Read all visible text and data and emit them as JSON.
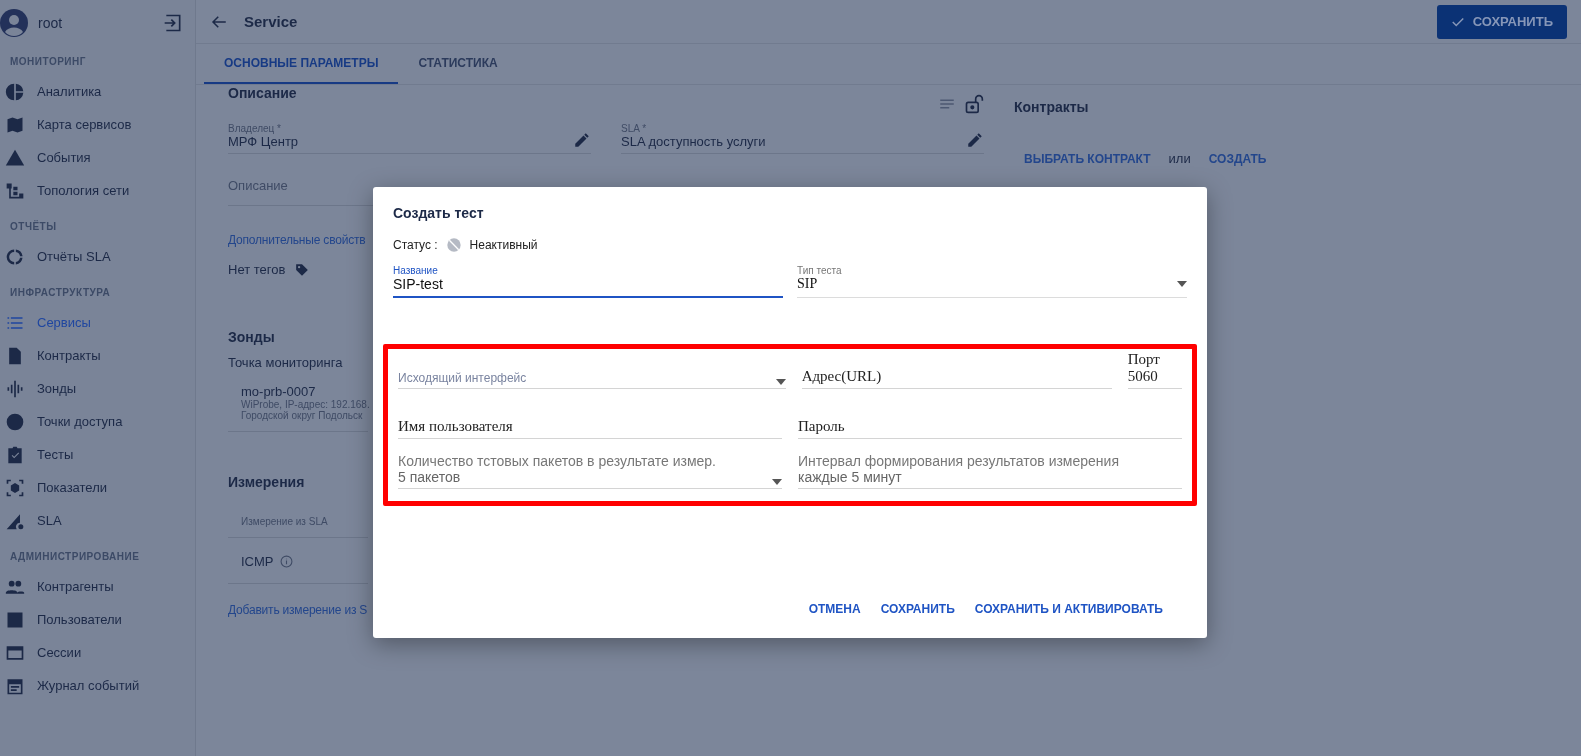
{
  "user": {
    "name": "root"
  },
  "sidebar": [
    {
      "title": "МОНИТОРИНГ",
      "items": [
        {
          "label": "Аналитика",
          "selected": false
        },
        {
          "label": "Карта сервисов",
          "selected": false
        },
        {
          "label": "События",
          "selected": false
        },
        {
          "label": "Топология сети",
          "selected": false
        }
      ]
    },
    {
      "title": "ОТЧЁТЫ",
      "items": [
        {
          "label": "Отчёты SLA",
          "selected": false
        }
      ]
    },
    {
      "title": "ИНФРАСТРУКТУРА",
      "items": [
        {
          "label": "Сервисы",
          "selected": true
        },
        {
          "label": "Контракты",
          "selected": false
        },
        {
          "label": "Зонды",
          "selected": false
        },
        {
          "label": "Точки доступа",
          "selected": false
        },
        {
          "label": "Тесты",
          "selected": false
        },
        {
          "label": "Показатели",
          "selected": false
        },
        {
          "label": "SLA",
          "selected": false
        }
      ]
    },
    {
      "title": "АДМИНИСТРИРОВАНИЕ",
      "items": [
        {
          "label": "Контрагенты",
          "selected": false
        },
        {
          "label": "Пользователи",
          "selected": false
        },
        {
          "label": "Сессии",
          "selected": false
        },
        {
          "label": "Журнал событий",
          "selected": false
        }
      ]
    }
  ],
  "header": {
    "title": "Service",
    "save": "СОХРАНИТЬ"
  },
  "tabs": [
    {
      "label": "ОСНОВНЫЕ ПАРАМЕТРЫ",
      "selected": true
    },
    {
      "label": "СТАТИСТИКА",
      "selected": false
    }
  ],
  "description": {
    "heading": "Описание",
    "owner": {
      "label": "Владелец *",
      "value": "МРФ Центр"
    },
    "sla": {
      "label": "SLA *",
      "value": "SLA доступность услуги"
    },
    "placeholder": "Описание",
    "extra_link": "Дополнительные свойств",
    "tags": "Нет тегов"
  },
  "probes": {
    "heading": "Зонды",
    "label": "Точка мониторинга",
    "name": "mo-prb-0007",
    "line1": "WiProbe, IP-адрес: 192.168.",
    "line2": "Городской округ Подольск"
  },
  "measurements": {
    "heading": "Измерения",
    "column": "Измерение из SLA",
    "rows": [
      "ICMP"
    ],
    "add_link": "Добавить измерение из S"
  },
  "contracts": {
    "heading": "Контракты",
    "choose": "ВЫБРАТЬ КОНТРАКТ",
    "or": "или",
    "create": "СОЗДАТЬ"
  },
  "modal": {
    "title": "Создать тест",
    "status_label": "Статус :",
    "status": "Неактивный",
    "name": {
      "label": "Название",
      "value": "SIP-test"
    },
    "type": {
      "label": "Тип теста",
      "value": "SIP"
    },
    "rows": [
      [
        {
          "kind": "select",
          "placeholder": "Исходящий интерфейс"
        },
        {
          "kind": "input",
          "placeholder": "Адрес(URL)"
        },
        {
          "kind": "port",
          "label": "Порт",
          "value": "5060"
        }
      ],
      [
        {
          "kind": "input",
          "placeholder": "Имя пользователя"
        },
        {
          "kind": "input",
          "placeholder": "Пароль"
        }
      ],
      [
        {
          "kind": "bigselect",
          "label": "Количество тстовых пакетов в результате измер.",
          "value": "5 пакетов"
        },
        {
          "kind": "bigfield",
          "label": "Интервал формирования результатов измерения",
          "value": "каждые 5 минут"
        }
      ]
    ],
    "buttons": [
      "ОТМЕНА",
      "СОХРАНИТЬ",
      "СОХРАНИТЬ И АКТИВИРОВАТЬ"
    ]
  }
}
